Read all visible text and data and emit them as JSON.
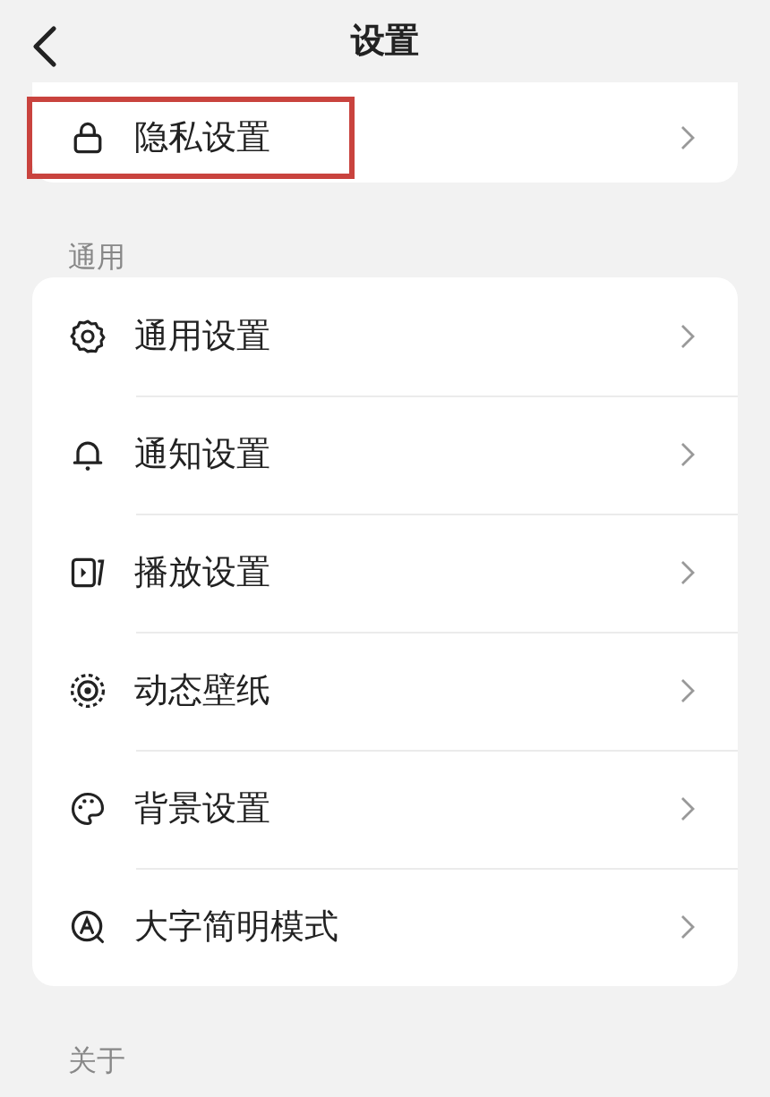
{
  "header": {
    "title": "设置"
  },
  "top_items": [
    {
      "label": "隐私设置",
      "highlighted": true
    }
  ],
  "sections": [
    {
      "title": "通用",
      "items": [
        {
          "label": "通用设置",
          "highlighted": false
        },
        {
          "label": "通知设置",
          "highlighted": false
        },
        {
          "label": "播放设置",
          "highlighted": false
        },
        {
          "label": "动态壁纸",
          "highlighted": false
        },
        {
          "label": "背景设置",
          "highlighted": false
        },
        {
          "label": "大字简明模式",
          "highlighted": false
        }
      ]
    },
    {
      "title": "关于"
    }
  ]
}
